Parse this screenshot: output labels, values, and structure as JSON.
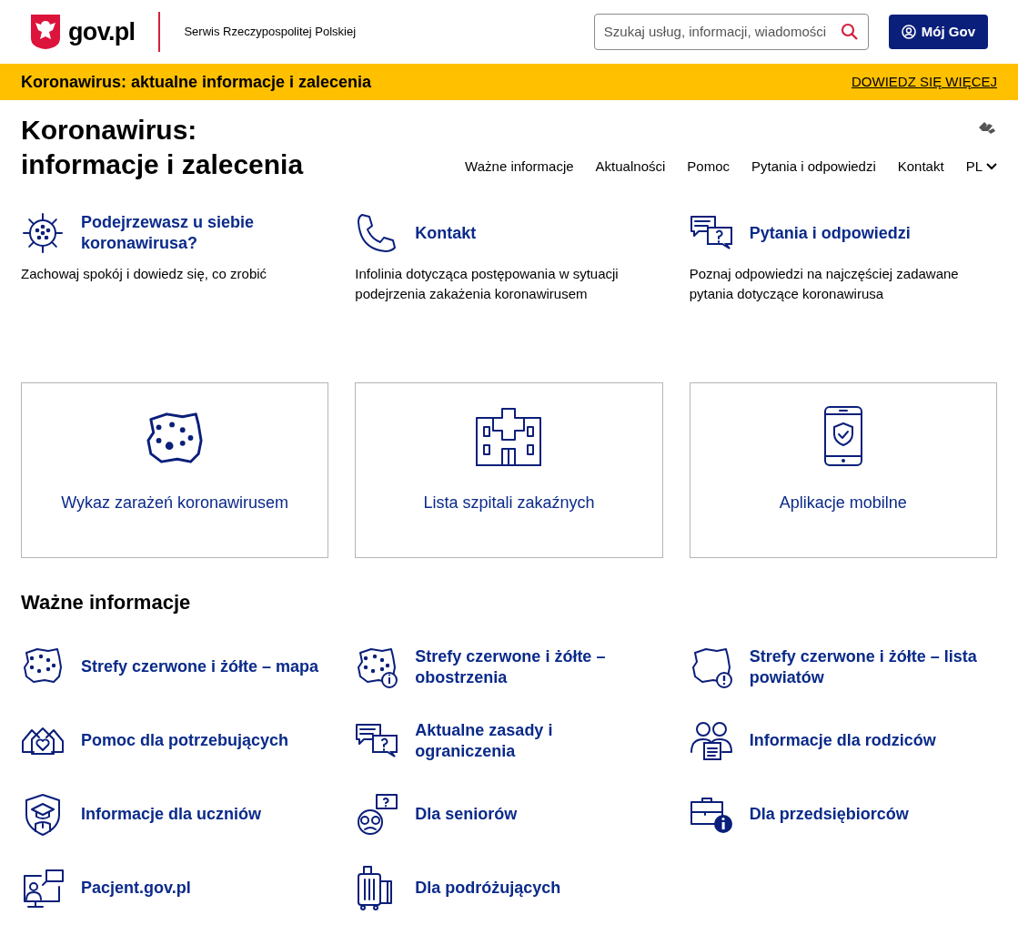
{
  "header": {
    "logo_text": "gov.pl",
    "tagline": "Serwis Rzeczypospolitej Polskiej",
    "search": {
      "placeholder": "Szukaj usług, informacji, wiadomości"
    },
    "account_button": "Mój Gov"
  },
  "banner": {
    "text": "Koronawirus: aktualne informacje i zalecenia",
    "link": "DOWIEDZ SIĘ WIĘCEJ"
  },
  "page": {
    "title_lines": [
      "Koronawirus:",
      "informacje i zalecenia"
    ],
    "nav": [
      {
        "label": "Ważne informacje"
      },
      {
        "label": "Aktualności"
      },
      {
        "label": "Pomoc"
      },
      {
        "label": "Pytania i odpowiedzi"
      },
      {
        "label": "Kontakt"
      }
    ],
    "language": "PL"
  },
  "featured": [
    {
      "title": "Podejrzewasz u siebie koronawirusa?",
      "description": "Zachowaj spokój i dowiedz się, co zrobić"
    },
    {
      "title": "Kontakt",
      "description": "Infolinia dotycząca postępowania w sytuacji podejrzenia zakażenia koronawirusem"
    },
    {
      "title": "Pytania i odpowiedzi",
      "description": "Poznaj odpowiedzi na najczęściej zadawane pytania dotyczące koronawirusa"
    }
  ],
  "tiles": [
    {
      "label": "Wykaz zarażeń koronawirusem"
    },
    {
      "label": "Lista szpitali zakaźnych"
    },
    {
      "label": "Aplikacje mobilne"
    }
  ],
  "important": {
    "heading": "Ważne informacje",
    "links": [
      {
        "label": "Strefy czerwone i żółte – mapa"
      },
      {
        "label": "Strefy czerwone i żółte – obostrzenia"
      },
      {
        "label": "Strefy czerwone i żółte – lista powiatów"
      },
      {
        "label": "Pomoc dla potrzebujących"
      },
      {
        "label": "Aktualne zasady i ograniczenia"
      },
      {
        "label": "Informacje dla rodziców"
      },
      {
        "label": "Informacje dla uczniów"
      },
      {
        "label": "Dla seniorów"
      },
      {
        "label": "Dla przedsiębiorców"
      },
      {
        "label": "Pacjent.gov.pl"
      },
      {
        "label": "Dla podróżujących"
      }
    ]
  }
}
